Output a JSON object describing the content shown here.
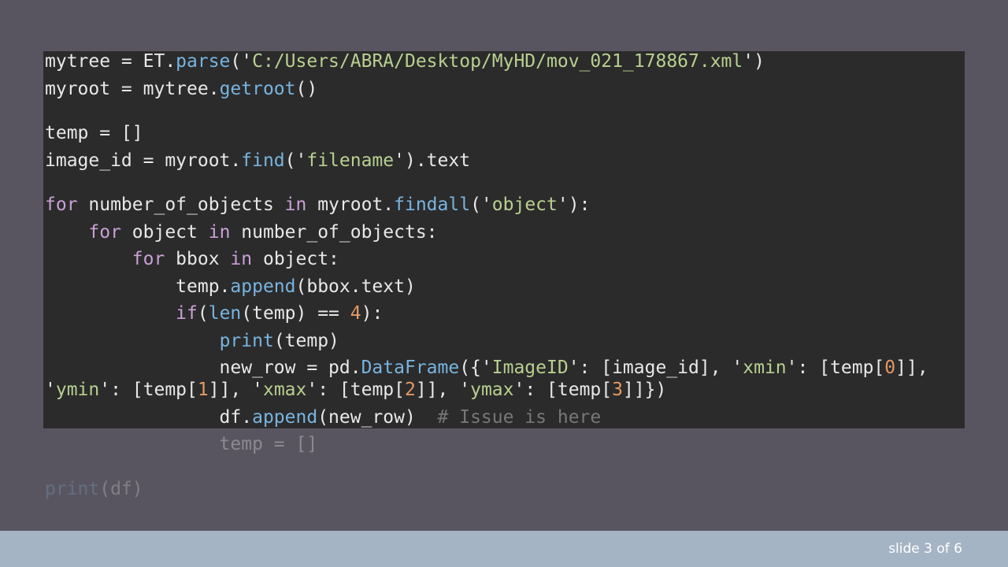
{
  "code": {
    "lines": [
      "mytree = ET.parse('C:/Users/ABRA/Desktop/MyHD/mov_021_178867.xml')",
      "myroot = mytree.getroot()",
      "temp = []",
      "image_id = myroot.find('filename').text",
      "for number_of_objects in myroot.findall('object'):",
      "    for object in number_of_objects:",
      "        for bbox in object:",
      "            temp.append(bbox.text)",
      "            if(len(temp) == 4):",
      "                print(temp)",
      "                new_row = pd.DataFrame({'ImageID': [image_id], 'xmin': [temp[0]],",
      "'ymin': [temp[1]], 'xmax': [temp[2]], 'ymax': [temp[3]]})",
      "                df.append(new_row)  # Issue is here",
      "                temp = []",
      "print(df)"
    ]
  },
  "colors": {
    "background": "#595560",
    "code_panel": "#2b2b2b",
    "keyword": "#c9a0d6",
    "function": "#78b4e0",
    "string": "#b8d090",
    "number": "#e39a64",
    "comment": "#777777",
    "footer": "#a5b4c4"
  },
  "footer": {
    "slide_counter": "slide 3 of 6"
  }
}
